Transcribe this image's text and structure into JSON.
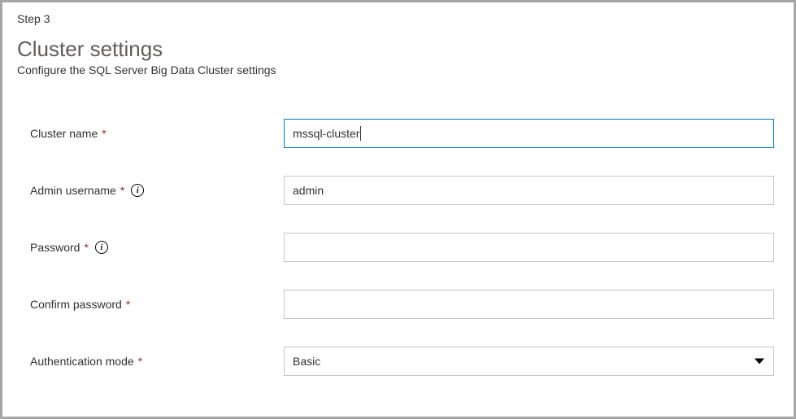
{
  "step": "Step 3",
  "title": "Cluster settings",
  "subtitle": "Configure the SQL Server Big Data Cluster settings",
  "fields": {
    "cluster_name": {
      "label": "Cluster name",
      "value": "mssql-cluster"
    },
    "admin_username": {
      "label": "Admin username",
      "value": "admin"
    },
    "password": {
      "label": "Password",
      "value": ""
    },
    "confirm_password": {
      "label": "Confirm password",
      "value": ""
    },
    "auth_mode": {
      "label": "Authentication mode",
      "value": "Basic"
    }
  },
  "info_icon_text": "i"
}
